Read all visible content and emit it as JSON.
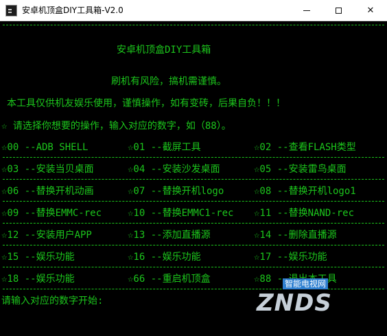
{
  "window": {
    "title": "安卓机顶盒DIY工具箱-V2.0",
    "controls": {
      "close": "✕"
    }
  },
  "console": {
    "header_title": "安卓机顶盒DIY工具箱",
    "warning": "刷机有风险，搞机需谨慎。",
    "disclaimer": "本工具仅供机友娱乐使用，谨慎操作，如有变砖，后果自负！！！",
    "instruction": "☆ 请选择你想要的操作，输入对应的数字，如（88）。",
    "menu_rows": [
      [
        "☆00 --ADB SHELL",
        "☆01 --截屏工具",
        "☆02 --查看FLASH类型"
      ],
      [
        "☆03 --安装当贝桌面",
        "☆04 --安装沙发桌面",
        "☆05 --安装雷鸟桌面"
      ],
      [
        "☆06 --替换开机动画",
        "☆07 --替换开机logo",
        "☆08 --替换开机logo1"
      ],
      [
        "☆09 --替换EMMC-rec",
        "☆10 --替换EMMC1-rec",
        "☆11 --替换NAND-rec"
      ],
      [
        "☆12 --安装用户APP",
        "☆13 --添加直播源",
        "☆14 --删除直播源"
      ],
      [
        "☆15 --娱乐功能",
        "☆16 --娱乐功能",
        "☆17 --娱乐功能"
      ],
      [
        "☆18 --娱乐功能",
        "☆66 --重启机顶盒",
        "☆88 --退出本工具"
      ]
    ],
    "prompt": "请输入对应的数字开始:"
  },
  "watermark": {
    "logo": "ZNDS",
    "tag": "智能电视网"
  },
  "colors": {
    "console_text": "#1cc61c",
    "console_bg": "#000000",
    "titlebar_bg": "#ffffff"
  }
}
